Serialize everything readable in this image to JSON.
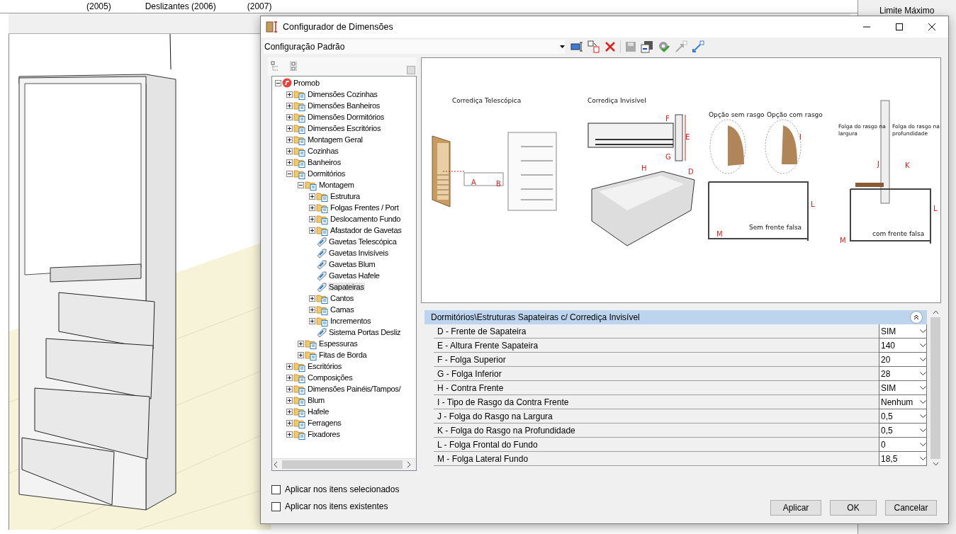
{
  "background_app": {
    "column_headers": [
      "(2005)",
      "Deslizantes (2006)",
      "(2007)"
    ],
    "side_panel_label": "Limite Máximo"
  },
  "window": {
    "title": "Configurador de Dimensões",
    "configuration": "Configuração Padrão",
    "tree": [
      {
        "label": "Promob",
        "kind": "root",
        "expanded": true,
        "selected": false,
        "children": [
          {
            "label": "Dimensões Cozinhas",
            "kind": "folder",
            "expanded": false,
            "selected": false
          },
          {
            "label": "Dimensões Banheiros",
            "kind": "folder",
            "expanded": false,
            "selected": false
          },
          {
            "label": "Dimensões Dormitórios",
            "kind": "folder",
            "expanded": false,
            "selected": false
          },
          {
            "label": "Dimensões Escritórios",
            "kind": "folder",
            "expanded": false,
            "selected": false
          },
          {
            "label": "Montagem Geral",
            "kind": "folder",
            "expanded": false,
            "selected": false
          },
          {
            "label": "Cozinhas",
            "kind": "folder",
            "expanded": false,
            "selected": false
          },
          {
            "label": "Banheiros",
            "kind": "folder",
            "expanded": false,
            "selected": false
          },
          {
            "label": "Dormitórios",
            "kind": "folder",
            "expanded": true,
            "selected": false,
            "children": [
              {
                "label": "Montagem",
                "kind": "folder",
                "expanded": true,
                "selected": false,
                "children": [
                  {
                    "label": "Estrutura",
                    "kind": "folder",
                    "expanded": false,
                    "selected": false
                  },
                  {
                    "label": "Folgas Frentes / Port",
                    "kind": "folder",
                    "expanded": false,
                    "selected": false
                  },
                  {
                    "label": "Deslocamento Fundo",
                    "kind": "folder",
                    "expanded": false,
                    "selected": false
                  },
                  {
                    "label": "Afastador de Gavetas",
                    "kind": "folder",
                    "expanded": false,
                    "selected": false
                  },
                  {
                    "label": "Gavetas Telescópica",
                    "kind": "item",
                    "selected": false
                  },
                  {
                    "label": "Gavetas Invisíveis",
                    "kind": "item",
                    "selected": false
                  },
                  {
                    "label": "Gavetas Blum",
                    "kind": "item",
                    "selected": false
                  },
                  {
                    "label": "Gavetas Hafele",
                    "kind": "item",
                    "selected": false
                  },
                  {
                    "label": "Sapateiras",
                    "kind": "item",
                    "selected": true
                  },
                  {
                    "label": "Cantos",
                    "kind": "folder",
                    "expanded": false,
                    "selected": false
                  },
                  {
                    "label": "Camas",
                    "kind": "folder",
                    "expanded": false,
                    "selected": false
                  },
                  {
                    "label": "Incrementos",
                    "kind": "folder",
                    "expanded": false,
                    "selected": false
                  },
                  {
                    "label": "Sistema Portas Desliz",
                    "kind": "item",
                    "selected": false
                  }
                ]
              },
              {
                "label": "Espessuras",
                "kind": "folder",
                "expanded": false,
                "selected": false
              },
              {
                "label": "Fitas de Borda",
                "kind": "folder",
                "expanded": false,
                "selected": false
              }
            ]
          },
          {
            "label": "Escritórios",
            "kind": "folder",
            "expanded": false,
            "selected": false
          },
          {
            "label": "Composições",
            "kind": "folder",
            "expanded": false,
            "selected": false
          },
          {
            "label": "Dimensões Painéis/Tampos/",
            "kind": "folder",
            "expanded": false,
            "selected": false
          },
          {
            "label": "Blum",
            "kind": "folder",
            "expanded": false,
            "selected": false
          },
          {
            "label": "Hafele",
            "kind": "folder",
            "expanded": false,
            "selected": false
          },
          {
            "label": "Ferragens",
            "kind": "folder",
            "expanded": false,
            "selected": false
          },
          {
            "label": "Fixadores",
            "kind": "folder",
            "expanded": false,
            "selected": false
          }
        ]
      }
    ],
    "apply_options": [
      {
        "label": "Aplicar nos itens selecionados",
        "checked": false
      },
      {
        "label": "Aplicar nos itens existentes",
        "checked": false
      }
    ],
    "diagram": {
      "labels": [
        "Corrediça Telescópica",
        "A",
        "B",
        "Corrediça Invisível",
        "F",
        "E",
        "G",
        "H",
        "D",
        "Opção sem rasgo",
        "Opção com rasgo",
        "I",
        "Folga do rasgo na largura",
        "Folga do rasgo na profundidade",
        "J",
        "K",
        "L",
        "M",
        "Sem frente falsa",
        "L",
        "M",
        "com frente falsa"
      ]
    },
    "properties": {
      "group": "Dormitórios\\Estruturas Sapateiras c/ Corrediça Invisível",
      "expanded": true,
      "rows": [
        {
          "label": "D - Frente de Sapateira",
          "value": "SIM"
        },
        {
          "label": "E - Altura Frente Sapateira",
          "value": "140"
        },
        {
          "label": "F - Folga Superior",
          "value": "20"
        },
        {
          "label": "G - Folga Inferior",
          "value": "28"
        },
        {
          "label": "H - Contra Frente",
          "value": "SIM"
        },
        {
          "label": "I -  Tipo de Rasgo da Contra Frente",
          "value": "Nenhum"
        },
        {
          "label": "J - Folga do Rasgo na Largura",
          "value": "0,5"
        },
        {
          "label": "K - Folga do Rasgo na Profundidade",
          "value": "0,5"
        },
        {
          "label": "L - Folga Frontal do Fundo",
          "value": "0"
        },
        {
          "label": "M - Folga Lateral Fundo",
          "value": "18,5"
        }
      ]
    },
    "buttons": [
      "Aplicar",
      "OK",
      "Cancelar"
    ]
  }
}
